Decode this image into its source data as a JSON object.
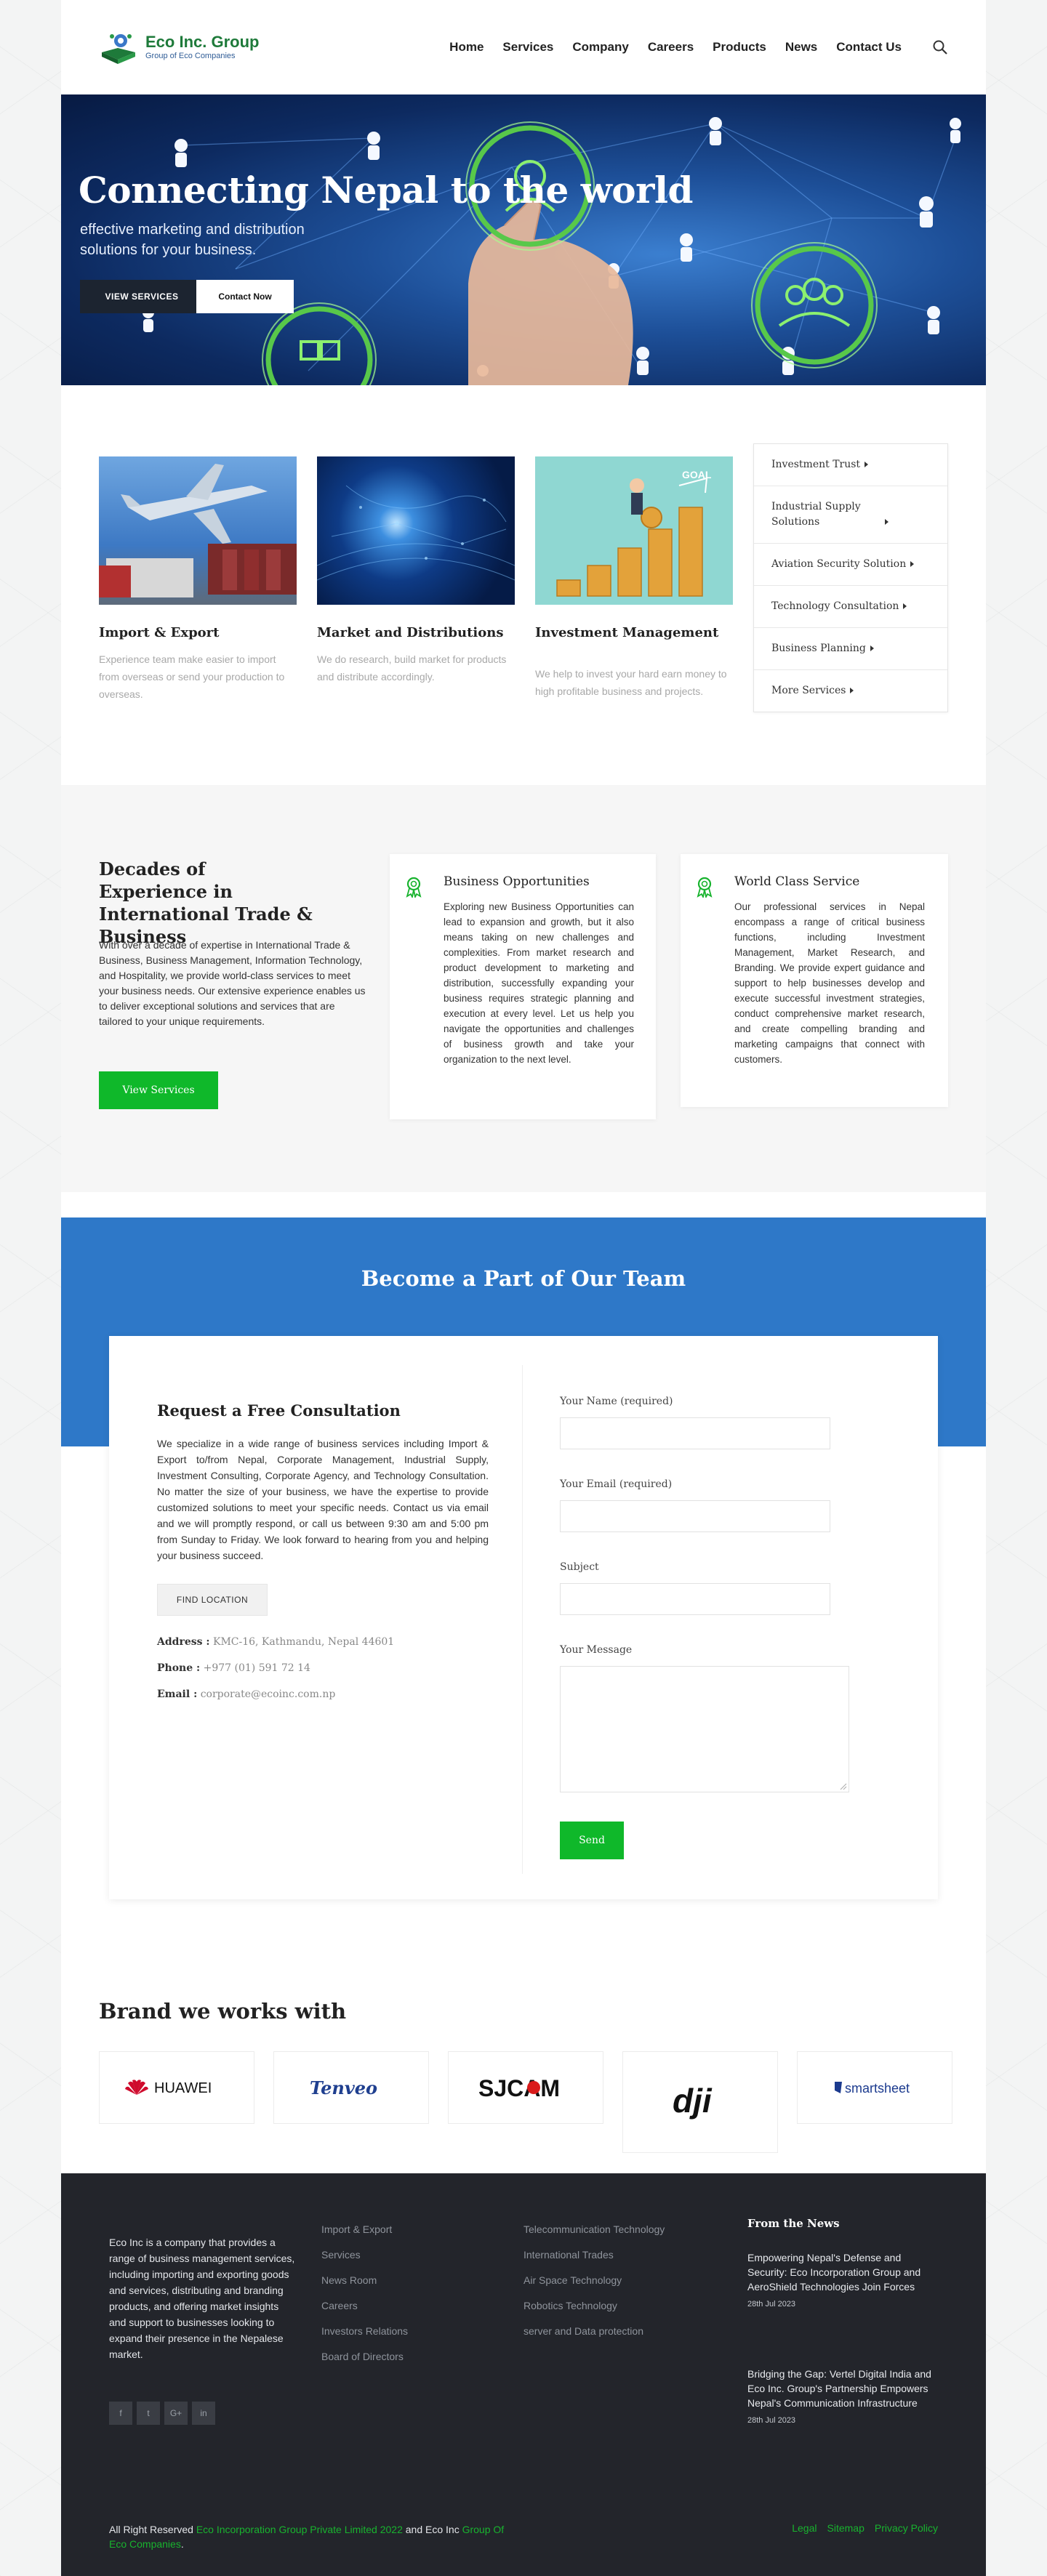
{
  "header": {
    "logo_name": "Eco Inc. Group",
    "logo_sub": "Group of Eco Companies",
    "nav": [
      "Home",
      "Services",
      "Company",
      "Careers",
      "Products",
      "News",
      "Contact Us"
    ]
  },
  "hero": {
    "title": "Connecting Nepal to the world",
    "subtitle": "effective marketing and distribution solutions for your business.",
    "btn_primary": "VIEW SERVICES",
    "btn_secondary": "Contact Now"
  },
  "services": [
    {
      "title": "Import & Export",
      "text": "Experience team make easier to import from overseas or send your production to overseas."
    },
    {
      "title": "Market and Distributions",
      "text": "We do research, build market for products and distribute accordingly."
    },
    {
      "title": "Investment Management",
      "text": "We help to invest your hard earn money to high profitable business and projects."
    }
  ],
  "side_list": [
    "Investment Trust",
    "Industrial Supply Solutions",
    "Aviation Security Solution",
    "Technology Consultation",
    "Business Planning",
    "More Services"
  ],
  "decades": {
    "title_line1": "Decades of",
    "title_line2": "Experience in International Trade & Business",
    "text": "With over a decade of expertise in International Trade & Business, Business Management, Information Technology, and Hospitality, we provide world-class services to meet your business needs. Our extensive experience enables us to deliver exceptional solutions and services that are tailored to your unique requirements.",
    "button": "View Services",
    "boxes": [
      {
        "title": "Business Opportunities",
        "text": "Exploring new Business Opportunities can lead to expansion and growth, but it also means taking on new challenges and complexities. From market research and product development to marketing and distribution, successfully expanding your business requires strategic planning and execution at every level. Let us help you navigate the opportunities and challenges of business growth and take your organization to the next level."
      },
      {
        "title": "World Class Service",
        "text": "Our professional services in Nepal encompass a range of critical business functions, including Investment Management, Market Research, and Branding. We provide expert guidance and support to help businesses develop and execute successful investment strategies, conduct comprehensive market research, and create compelling branding and marketing campaigns that connect with customers."
      }
    ]
  },
  "team": {
    "title": "Become a Part of Our Team",
    "consult_title": "Request a Free Consultation",
    "consult_text": "We specialize in a wide range of business services including Import & Export to/from Nepal, Corporate Management, Industrial Supply, Investment Consulting, Corporate Agency, and Technology Consultation. No matter the size of your business, we have the expertise to provide customized solutions to meet your specific needs. Contact us via email and we will promptly respond, or call us between 9:30 am and 5:00 pm from Sunday to Friday. We look forward to hearing from you and helping your business succeed.",
    "find_location": "FIND LOCATION",
    "address_label": "Address :",
    "address": "KMC-16, Kathmandu, Nepal 44601",
    "phone_label": "Phone :",
    "phone": "+977 (01) 591 72 14",
    "email_label": "Email :",
    "email": "corporate@ecoinc.com.np",
    "form": {
      "name_label": "Your Name (required)",
      "email_label": "Your Email (required)",
      "subject_label": "Subject",
      "message_label": "Your Message",
      "send": "Send"
    }
  },
  "brands": {
    "title": "Brand we works with",
    "items": [
      "HUAWEI",
      "Tenveo",
      "SJCAM",
      "dji",
      "smartsheet"
    ]
  },
  "footer": {
    "about": "Eco Inc is a company that provides a range of business management services, including importing and exporting goods and services, distributing and branding products, and offering market insights and support to businesses looking to expand their presence in the Nepalese market.",
    "socials": [
      "f",
      "t",
      "G+",
      "in"
    ],
    "col1": [
      "Import & Export",
      "Services",
      "News Room",
      "Careers",
      "Investors Relations",
      "Board of Directors"
    ],
    "col2": [
      "Telecommunication Technology",
      "International Trades",
      "Air Space Technology",
      "Robotics Technology",
      "server and Data protection"
    ],
    "news_title": "From the News",
    "news": [
      {
        "title": "Empowering Nepal's Defense and Security: Eco Incorporation Group and AeroShield Technologies Join Forces",
        "date": "28th Jul 2023"
      },
      {
        "title": "Bridging the Gap: Vertel Digital India and Eco Inc. Group's Partnership Empowers Nepal's Communication Infrastructure",
        "date": "28th Jul 2023"
      }
    ],
    "copy_prefix": "All Right Reserved ",
    "copy_link": "Eco Incorporation Group Private Limited 2022",
    "copy_mid": " and Eco Inc ",
    "copy_link2": "Group Of Eco Companies",
    "copy_end": ".",
    "links": [
      "Legal",
      "Sitemap",
      "Privacy Policy"
    ]
  },
  "colors": {
    "accent_green": "#0fb82a",
    "band_blue": "#2e78c8",
    "footer_bg": "#23252b"
  }
}
